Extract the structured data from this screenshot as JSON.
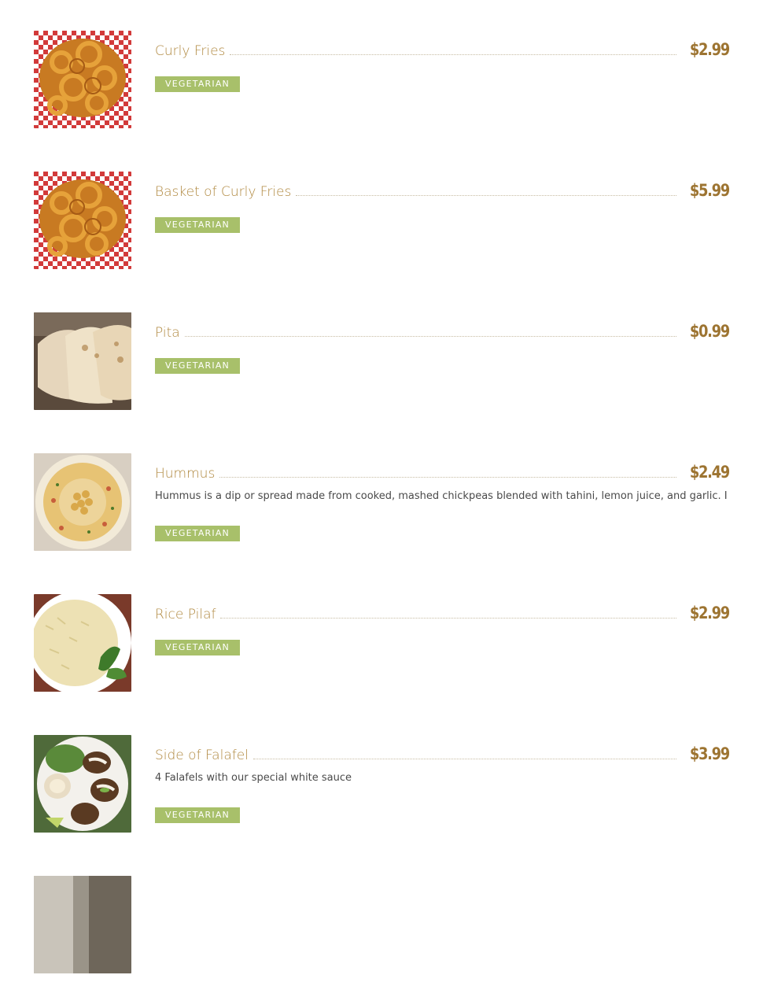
{
  "menu": {
    "items": [
      {
        "name": "Curly Fries",
        "price": "$2.99",
        "description": "",
        "tag": "VEGETARIAN",
        "image": "curly-fries-image"
      },
      {
        "name": "Basket of Curly Fries",
        "price": "$5.99",
        "description": "",
        "tag": "VEGETARIAN",
        "image": "curly-fries-basket-image"
      },
      {
        "name": "Pita",
        "price": "$0.99",
        "description": "",
        "tag": "VEGETARIAN",
        "image": "pita-image"
      },
      {
        "name": "Hummus",
        "price": "$2.49",
        "description": "Hummus is a dip or spread made from cooked, mashed chickpeas blended with tahini, lemon juice, and garlic. I",
        "tag": "VEGETARIAN",
        "image": "hummus-image"
      },
      {
        "name": "Rice Pilaf",
        "price": "$2.99",
        "description": "",
        "tag": "VEGETARIAN",
        "image": "rice-pilaf-image"
      },
      {
        "name": "Side of Falafel",
        "price": "$3.99",
        "description": "4 Falafels with our special white sauce",
        "tag": "VEGETARIAN",
        "image": "falafel-image"
      },
      {
        "name": "",
        "price": "",
        "description": "",
        "tag": "",
        "image": "partial-item-image"
      }
    ]
  },
  "colors": {
    "name": "#b0883f",
    "price": "#9d7431",
    "badge": "#a8c06a",
    "description": "#4a4a4a"
  }
}
